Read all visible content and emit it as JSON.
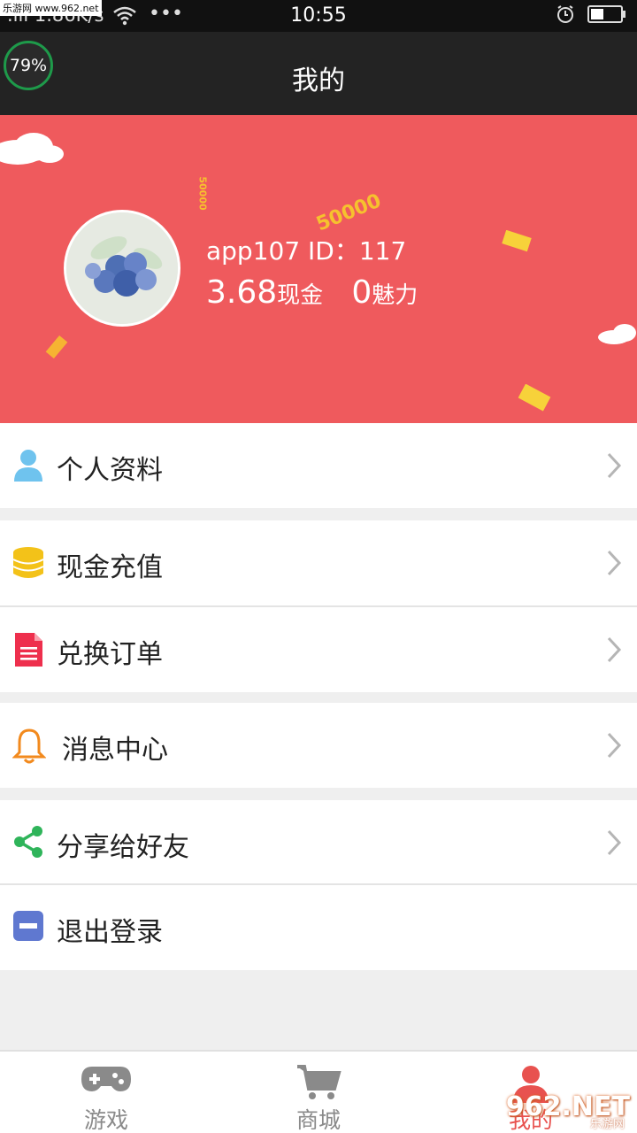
{
  "status_bar": {
    "network_speed": ".ıll 1.86K/s",
    "time": "10:55",
    "watermark": "乐游网 www.962.net"
  },
  "header": {
    "title": "我的",
    "badge": "79%"
  },
  "profile": {
    "username_id": "app107 ID：117",
    "cash_value": "3.68",
    "cash_unit": "现金",
    "charm_value": "0",
    "charm_unit": "魅力",
    "decor_money": "50000",
    "decor_money_small": "50000"
  },
  "menu": {
    "profile_label": "个人资料",
    "recharge_label": "现金充值",
    "orders_label": "兑换订单",
    "messages_label": "消息中心",
    "share_label": "分享给好友",
    "logout_label": "退出登录"
  },
  "tabs": {
    "games": "游戏",
    "shop": "商城",
    "mine": "我的"
  },
  "watermark": {
    "brand": "962.NET",
    "brand_sub": "乐游网"
  },
  "colors": {
    "hero_bg": "#ef5a5d",
    "header_bg": "#232323",
    "active_tab": "#e8524f",
    "inactive_tab": "#8a8a8a"
  }
}
